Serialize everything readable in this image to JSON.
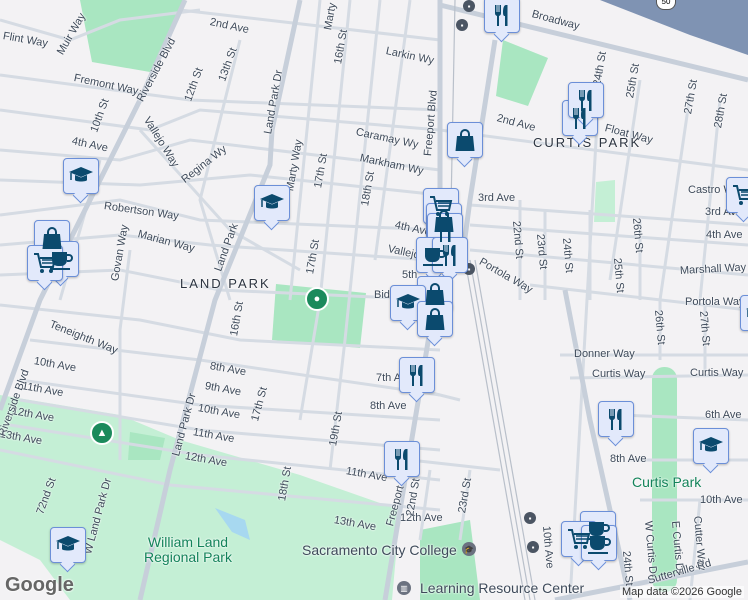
{
  "map": {
    "colors": {
      "background": "#f3f2f4",
      "park": "#a9e6c1",
      "park_light": "#c4efd5",
      "road": "#d5dbe3",
      "major_road": "#c7cfda",
      "highway": "#7f93b3",
      "marker_fill": "#e2e9fb",
      "marker_border": "#6b8fd8",
      "icon": "#0b4a6e",
      "water": "#a7d8f0"
    },
    "neighborhoods": [
      "LAND PARK",
      "CURTIS PARK"
    ],
    "parks": [
      "William Land Regional Park",
      "Curtis Park"
    ],
    "pois": [
      "Sacramento City College",
      "Learning Resource Center"
    ],
    "highway_shield": "50",
    "streets": [
      "2nd Ave",
      "Flint Way",
      "Muir Way",
      "Fremont Way",
      "Riverside Blvd",
      "12th St",
      "13th St",
      "Land Park Dr",
      "Marty Way",
      "16th St",
      "10th St",
      "Vallejo Way",
      "4th Ave",
      "Regina Wy",
      "Robertson Way",
      "Marian Way",
      "Govan Way",
      "Land Park",
      "Marty Way",
      "17th St",
      "17th St",
      "18th St",
      "Larkin Wy",
      "Caramay Wy",
      "Markham Wy",
      "Freeport Blvd",
      "Broadway",
      "2nd Ave",
      "24th St",
      "25th St",
      "27th St",
      "28th St",
      "Float Way",
      "3rd Ave",
      "Castro Way",
      "3rd Ave",
      "4th Ave",
      "Marshall Way",
      "Portola Way",
      "4th Ave",
      "Vallejo",
      "5th",
      "Portola Way",
      "22nd St",
      "23rd St",
      "24th St",
      "25th St",
      "26th St",
      "Bid",
      "26th St",
      "27th St",
      "Donner Way",
      "Curtis Way",
      "Curtis Way",
      "6th Ave",
      "8th Ave",
      "10th Ave",
      "W Curtis Dr",
      "E Curtis Dr",
      "Cutter Way",
      "24th St",
      "Sutterville Rd",
      "10th Ave",
      "7th Ave",
      "8th Ave",
      "12th Ave",
      "22nd St",
      "23rd St",
      "Freeport Blvd",
      "Teneighth Way",
      "10th Ave",
      "11th Ave",
      "12th Ave",
      "13th Ave",
      "Riverside Blvd",
      "8th Ave",
      "9th Ave",
      "10th Ave",
      "11th Ave",
      "12th Ave",
      "13th Ave",
      "11th Ave",
      "Land Park Dr",
      "17th St",
      "19th St",
      "18th St",
      "16th St",
      "72nd St",
      "W Land Park Dr"
    ],
    "markers": [
      {
        "type": "education",
        "name": "school-marker"
      },
      {
        "type": "education",
        "name": "school-marker"
      },
      {
        "type": "shopping",
        "name": "shop-marker"
      },
      {
        "type": "cafe",
        "name": "cafe-marker"
      },
      {
        "type": "grocery",
        "name": "grocery-marker"
      },
      {
        "type": "education",
        "name": "school-marker"
      },
      {
        "type": "restaurant",
        "name": "restaurant-marker"
      },
      {
        "type": "shopping",
        "name": "shop-marker"
      },
      {
        "type": "restaurant",
        "name": "restaurant-marker"
      },
      {
        "type": "restaurant",
        "name": "restaurant-marker"
      },
      {
        "type": "grocery",
        "name": "grocery-marker"
      },
      {
        "type": "shopping",
        "name": "shop-marker"
      },
      {
        "type": "restaurant",
        "name": "restaurant-marker"
      },
      {
        "type": "cafe",
        "name": "cafe-marker"
      },
      {
        "type": "restaurant",
        "name": "restaurant-marker"
      },
      {
        "type": "shopping",
        "name": "shop-marker"
      },
      {
        "type": "education",
        "name": "school-marker"
      },
      {
        "type": "shopping",
        "name": "shop-marker"
      },
      {
        "type": "grocery",
        "name": "grocery-marker"
      },
      {
        "type": "education",
        "name": "school-marker"
      },
      {
        "type": "restaurant",
        "name": "restaurant-marker"
      },
      {
        "type": "restaurant",
        "name": "restaurant-marker"
      },
      {
        "type": "education",
        "name": "school-marker"
      },
      {
        "type": "restaurant",
        "name": "restaurant-marker"
      },
      {
        "type": "cafe",
        "name": "cafe-marker"
      },
      {
        "type": "grocery",
        "name": "grocery-marker"
      },
      {
        "type": "cafe",
        "name": "cafe-marker"
      }
    ],
    "attribution": "Map data ©2026 Google",
    "logo": "Google"
  }
}
